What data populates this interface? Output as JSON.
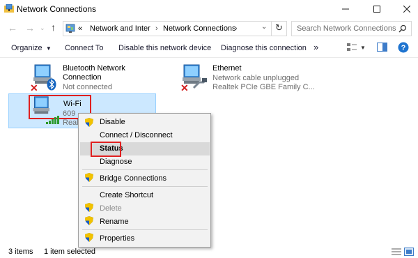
{
  "window": {
    "title": "Network Connections"
  },
  "address": {
    "chevrons": "«",
    "crumbs": [
      "Network and Inter",
      "Network Connections"
    ],
    "search_placeholder": "Search Network Connections"
  },
  "toolbar": {
    "organize": "Organize",
    "connect_to": "Connect To",
    "disable_device": "Disable this network device",
    "diagnose": "Diagnose this connection",
    "more": "»"
  },
  "items": [
    {
      "title_line1": "Bluetooth Network",
      "title_line2": "Connection",
      "status": "Not connected"
    },
    {
      "title": "Ethernet",
      "status": "Network cable unplugged",
      "device": "Realtek PCIe GBE Family C..."
    },
    {
      "title": "Wi-Fi",
      "status": "609",
      "device": "Realt"
    }
  ],
  "context_menu": {
    "items": [
      {
        "label": "Disable",
        "shield": true,
        "disabled": false
      },
      {
        "label": "Connect / Disconnect",
        "shield": false,
        "disabled": false
      },
      {
        "label": "Status",
        "shield": false,
        "disabled": false,
        "bold": true
      },
      {
        "label": "Diagnose",
        "shield": false,
        "disabled": false
      },
      {
        "label": "Bridge Connections",
        "shield": true,
        "disabled": false
      },
      {
        "label": "Create Shortcut",
        "shield": false,
        "disabled": false
      },
      {
        "label": "Delete",
        "shield": true,
        "disabled": true
      },
      {
        "label": "Rename",
        "shield": true,
        "disabled": false
      },
      {
        "label": "Properties",
        "shield": true,
        "disabled": false
      }
    ]
  },
  "status_bar": {
    "items_count": "3 items",
    "selected": "1 item selected"
  },
  "colors": {
    "accent": "#0078d7",
    "selection": "#cce8ff",
    "highlight_box": "#e02020"
  }
}
